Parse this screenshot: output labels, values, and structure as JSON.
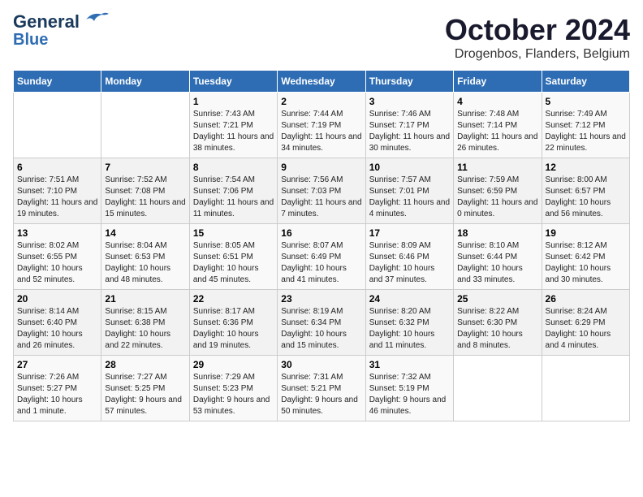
{
  "logo": {
    "line1": "General",
    "line2": "Blue"
  },
  "title": "October 2024",
  "location": "Drogenbos, Flanders, Belgium",
  "days_of_week": [
    "Sunday",
    "Monday",
    "Tuesday",
    "Wednesday",
    "Thursday",
    "Friday",
    "Saturday"
  ],
  "weeks": [
    [
      {
        "num": "",
        "sunrise": "",
        "sunset": "",
        "daylight": ""
      },
      {
        "num": "",
        "sunrise": "",
        "sunset": "",
        "daylight": ""
      },
      {
        "num": "1",
        "sunrise": "Sunrise: 7:43 AM",
        "sunset": "Sunset: 7:21 PM",
        "daylight": "Daylight: 11 hours and 38 minutes."
      },
      {
        "num": "2",
        "sunrise": "Sunrise: 7:44 AM",
        "sunset": "Sunset: 7:19 PM",
        "daylight": "Daylight: 11 hours and 34 minutes."
      },
      {
        "num": "3",
        "sunrise": "Sunrise: 7:46 AM",
        "sunset": "Sunset: 7:17 PM",
        "daylight": "Daylight: 11 hours and 30 minutes."
      },
      {
        "num": "4",
        "sunrise": "Sunrise: 7:48 AM",
        "sunset": "Sunset: 7:14 PM",
        "daylight": "Daylight: 11 hours and 26 minutes."
      },
      {
        "num": "5",
        "sunrise": "Sunrise: 7:49 AM",
        "sunset": "Sunset: 7:12 PM",
        "daylight": "Daylight: 11 hours and 22 minutes."
      }
    ],
    [
      {
        "num": "6",
        "sunrise": "Sunrise: 7:51 AM",
        "sunset": "Sunset: 7:10 PM",
        "daylight": "Daylight: 11 hours and 19 minutes."
      },
      {
        "num": "7",
        "sunrise": "Sunrise: 7:52 AM",
        "sunset": "Sunset: 7:08 PM",
        "daylight": "Daylight: 11 hours and 15 minutes."
      },
      {
        "num": "8",
        "sunrise": "Sunrise: 7:54 AM",
        "sunset": "Sunset: 7:06 PM",
        "daylight": "Daylight: 11 hours and 11 minutes."
      },
      {
        "num": "9",
        "sunrise": "Sunrise: 7:56 AM",
        "sunset": "Sunset: 7:03 PM",
        "daylight": "Daylight: 11 hours and 7 minutes."
      },
      {
        "num": "10",
        "sunrise": "Sunrise: 7:57 AM",
        "sunset": "Sunset: 7:01 PM",
        "daylight": "Daylight: 11 hours and 4 minutes."
      },
      {
        "num": "11",
        "sunrise": "Sunrise: 7:59 AM",
        "sunset": "Sunset: 6:59 PM",
        "daylight": "Daylight: 11 hours and 0 minutes."
      },
      {
        "num": "12",
        "sunrise": "Sunrise: 8:00 AM",
        "sunset": "Sunset: 6:57 PM",
        "daylight": "Daylight: 10 hours and 56 minutes."
      }
    ],
    [
      {
        "num": "13",
        "sunrise": "Sunrise: 8:02 AM",
        "sunset": "Sunset: 6:55 PM",
        "daylight": "Daylight: 10 hours and 52 minutes."
      },
      {
        "num": "14",
        "sunrise": "Sunrise: 8:04 AM",
        "sunset": "Sunset: 6:53 PM",
        "daylight": "Daylight: 10 hours and 48 minutes."
      },
      {
        "num": "15",
        "sunrise": "Sunrise: 8:05 AM",
        "sunset": "Sunset: 6:51 PM",
        "daylight": "Daylight: 10 hours and 45 minutes."
      },
      {
        "num": "16",
        "sunrise": "Sunrise: 8:07 AM",
        "sunset": "Sunset: 6:49 PM",
        "daylight": "Daylight: 10 hours and 41 minutes."
      },
      {
        "num": "17",
        "sunrise": "Sunrise: 8:09 AM",
        "sunset": "Sunset: 6:46 PM",
        "daylight": "Daylight: 10 hours and 37 minutes."
      },
      {
        "num": "18",
        "sunrise": "Sunrise: 8:10 AM",
        "sunset": "Sunset: 6:44 PM",
        "daylight": "Daylight: 10 hours and 33 minutes."
      },
      {
        "num": "19",
        "sunrise": "Sunrise: 8:12 AM",
        "sunset": "Sunset: 6:42 PM",
        "daylight": "Daylight: 10 hours and 30 minutes."
      }
    ],
    [
      {
        "num": "20",
        "sunrise": "Sunrise: 8:14 AM",
        "sunset": "Sunset: 6:40 PM",
        "daylight": "Daylight: 10 hours and 26 minutes."
      },
      {
        "num": "21",
        "sunrise": "Sunrise: 8:15 AM",
        "sunset": "Sunset: 6:38 PM",
        "daylight": "Daylight: 10 hours and 22 minutes."
      },
      {
        "num": "22",
        "sunrise": "Sunrise: 8:17 AM",
        "sunset": "Sunset: 6:36 PM",
        "daylight": "Daylight: 10 hours and 19 minutes."
      },
      {
        "num": "23",
        "sunrise": "Sunrise: 8:19 AM",
        "sunset": "Sunset: 6:34 PM",
        "daylight": "Daylight: 10 hours and 15 minutes."
      },
      {
        "num": "24",
        "sunrise": "Sunrise: 8:20 AM",
        "sunset": "Sunset: 6:32 PM",
        "daylight": "Daylight: 10 hours and 11 minutes."
      },
      {
        "num": "25",
        "sunrise": "Sunrise: 8:22 AM",
        "sunset": "Sunset: 6:30 PM",
        "daylight": "Daylight: 10 hours and 8 minutes."
      },
      {
        "num": "26",
        "sunrise": "Sunrise: 8:24 AM",
        "sunset": "Sunset: 6:29 PM",
        "daylight": "Daylight: 10 hours and 4 minutes."
      }
    ],
    [
      {
        "num": "27",
        "sunrise": "Sunrise: 7:26 AM",
        "sunset": "Sunset: 5:27 PM",
        "daylight": "Daylight: 10 hours and 1 minute."
      },
      {
        "num": "28",
        "sunrise": "Sunrise: 7:27 AM",
        "sunset": "Sunset: 5:25 PM",
        "daylight": "Daylight: 9 hours and 57 minutes."
      },
      {
        "num": "29",
        "sunrise": "Sunrise: 7:29 AM",
        "sunset": "Sunset: 5:23 PM",
        "daylight": "Daylight: 9 hours and 53 minutes."
      },
      {
        "num": "30",
        "sunrise": "Sunrise: 7:31 AM",
        "sunset": "Sunset: 5:21 PM",
        "daylight": "Daylight: 9 hours and 50 minutes."
      },
      {
        "num": "31",
        "sunrise": "Sunrise: 7:32 AM",
        "sunset": "Sunset: 5:19 PM",
        "daylight": "Daylight: 9 hours and 46 minutes."
      },
      {
        "num": "",
        "sunrise": "",
        "sunset": "",
        "daylight": ""
      },
      {
        "num": "",
        "sunrise": "",
        "sunset": "",
        "daylight": ""
      }
    ]
  ]
}
